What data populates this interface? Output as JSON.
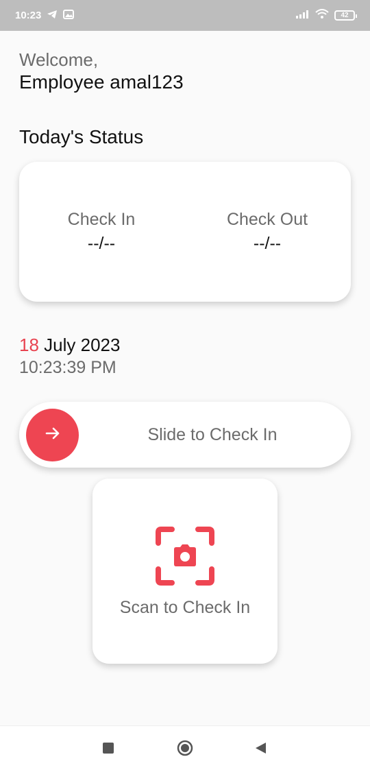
{
  "status_bar": {
    "time": "10:23",
    "battery": "42"
  },
  "header": {
    "welcome": "Welcome,",
    "employee": "Employee amal123"
  },
  "status": {
    "title": "Today's Status",
    "check_in_label": "Check In",
    "check_in_value": "--/--",
    "check_out_label": "Check Out",
    "check_out_value": "--/--"
  },
  "datetime": {
    "day": "18",
    "month_year": " July 2023",
    "time": "10:23:39 PM"
  },
  "slider": {
    "label": "Slide to Check In",
    "icon": "arrow-right-icon"
  },
  "scan": {
    "label": "Scan to Check In",
    "icon": "camera-scan-icon"
  },
  "colors": {
    "accent": "#ee4552",
    "text_primary": "#111111",
    "text_secondary": "#6b6b6b",
    "background": "#fafafa"
  }
}
